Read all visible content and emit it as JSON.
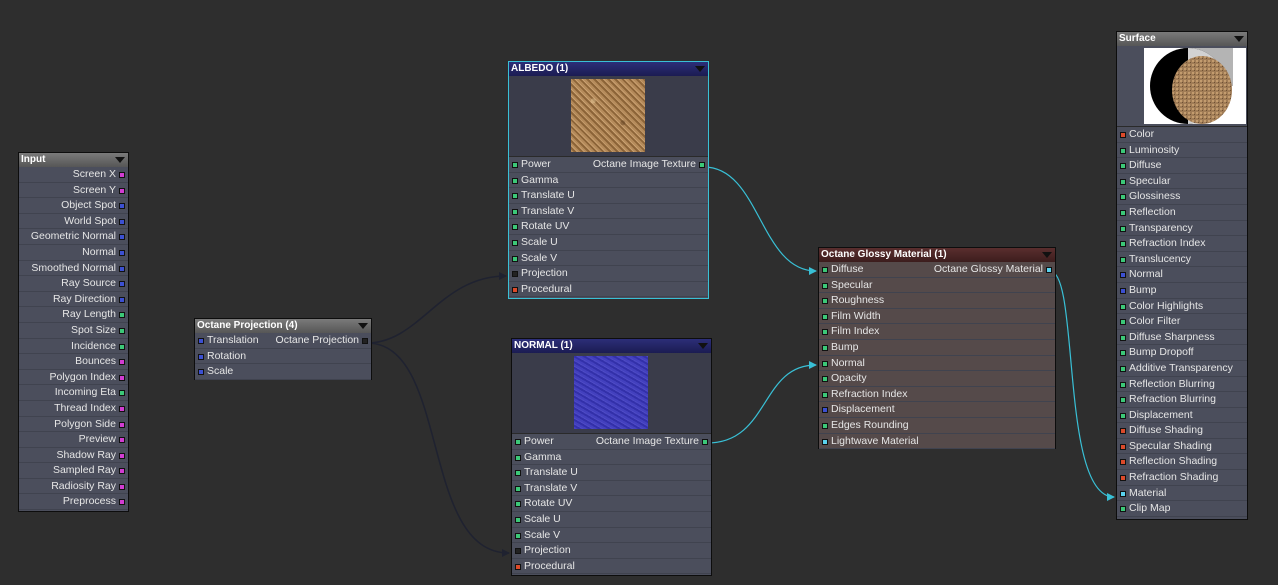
{
  "colors": {
    "canvas_bg": "#2e2e2e",
    "node_bg": "#4b4e5c",
    "wire_cyan": "#39c0d6",
    "wire_dark": "#1f2230",
    "port_magenta": "#d23cd2",
    "port_blue": "#3c50d2",
    "port_green": "#3cc878",
    "port_red": "#dc4a2a",
    "port_cyan": "#5ad2ee",
    "port_black": "#222222"
  },
  "input_node": {
    "title": "Input",
    "rows": [
      {
        "label": "Screen X",
        "port": "magenta"
      },
      {
        "label": "Screen Y",
        "port": "magenta"
      },
      {
        "label": "Object Spot",
        "port": "blue"
      },
      {
        "label": "World Spot",
        "port": "blue"
      },
      {
        "label": "Geometric Normal",
        "port": "blue"
      },
      {
        "label": "Normal",
        "port": "blue"
      },
      {
        "label": "Smoothed Normal",
        "port": "blue"
      },
      {
        "label": "Ray Source",
        "port": "blue"
      },
      {
        "label": "Ray Direction",
        "port": "blue"
      },
      {
        "label": "Ray Length",
        "port": "green"
      },
      {
        "label": "Spot Size",
        "port": "green"
      },
      {
        "label": "Incidence",
        "port": "green"
      },
      {
        "label": "Bounces",
        "port": "magenta"
      },
      {
        "label": "Polygon Index",
        "port": "magenta"
      },
      {
        "label": "Incoming Eta",
        "port": "green"
      },
      {
        "label": "Thread Index",
        "port": "magenta"
      },
      {
        "label": "Polygon Side",
        "port": "magenta"
      },
      {
        "label": "Preview",
        "port": "magenta"
      },
      {
        "label": "Shadow Ray",
        "port": "magenta"
      },
      {
        "label": "Sampled Ray",
        "port": "magenta"
      },
      {
        "label": "Radiosity Ray",
        "port": "magenta"
      },
      {
        "label": "Preprocess",
        "port": "magenta"
      }
    ]
  },
  "projection_node": {
    "title": "Octane Projection (4)",
    "output": "Octane Projection",
    "rows": [
      {
        "label": "Translation",
        "port": "blue"
      },
      {
        "label": "Rotation",
        "port": "blue"
      },
      {
        "label": "Scale",
        "port": "blue"
      }
    ]
  },
  "albedo_node": {
    "title": "ALBEDO (1)",
    "output": "Octane Image Texture",
    "rows": [
      {
        "label": "Power",
        "port": "green"
      },
      {
        "label": "Gamma",
        "port": "green"
      },
      {
        "label": "Translate U",
        "port": "green"
      },
      {
        "label": "Translate V",
        "port": "green"
      },
      {
        "label": "Rotate UV",
        "port": "green"
      },
      {
        "label": "Scale U",
        "port": "green"
      },
      {
        "label": "Scale V",
        "port": "green"
      },
      {
        "label": "Projection",
        "port": "black"
      },
      {
        "label": "Procedural",
        "port": "red"
      }
    ]
  },
  "normal_node": {
    "title": "NORMAL (1)",
    "output": "Octane Image Texture",
    "rows": [
      {
        "label": "Power",
        "port": "green"
      },
      {
        "label": "Gamma",
        "port": "green"
      },
      {
        "label": "Translate U",
        "port": "green"
      },
      {
        "label": "Translate V",
        "port": "green"
      },
      {
        "label": "Rotate UV",
        "port": "green"
      },
      {
        "label": "Scale U",
        "port": "green"
      },
      {
        "label": "Scale V",
        "port": "green"
      },
      {
        "label": "Projection",
        "port": "black"
      },
      {
        "label": "Procedural",
        "port": "red"
      }
    ]
  },
  "glossy_node": {
    "title": "Octane Glossy Material (1)",
    "output": "Octane Glossy Material",
    "rows": [
      {
        "label": "Diffuse",
        "port": "green"
      },
      {
        "label": "Specular",
        "port": "green"
      },
      {
        "label": "Roughness",
        "port": "green"
      },
      {
        "label": "Film Width",
        "port": "green"
      },
      {
        "label": "Film Index",
        "port": "green"
      },
      {
        "label": "Bump",
        "port": "green"
      },
      {
        "label": "Normal",
        "port": "green"
      },
      {
        "label": "Opacity",
        "port": "green"
      },
      {
        "label": "Refraction Index",
        "port": "green"
      },
      {
        "label": "Displacement",
        "port": "blue"
      },
      {
        "label": "Edges Rounding",
        "port": "green"
      },
      {
        "label": "Lightwave Material",
        "port": "cyan"
      }
    ]
  },
  "surface_node": {
    "title": "Surface",
    "rows": [
      {
        "label": "Color",
        "port": "red"
      },
      {
        "label": "Luminosity",
        "port": "green"
      },
      {
        "label": "Diffuse",
        "port": "green"
      },
      {
        "label": "Specular",
        "port": "green"
      },
      {
        "label": "Glossiness",
        "port": "green"
      },
      {
        "label": "Reflection",
        "port": "green"
      },
      {
        "label": "Transparency",
        "port": "green"
      },
      {
        "label": "Refraction Index",
        "port": "green"
      },
      {
        "label": "Translucency",
        "port": "green"
      },
      {
        "label": "Normal",
        "port": "blue"
      },
      {
        "label": "Bump",
        "port": "blue"
      },
      {
        "label": "Color Highlights",
        "port": "green"
      },
      {
        "label": "Color Filter",
        "port": "green"
      },
      {
        "label": "Diffuse Sharpness",
        "port": "green"
      },
      {
        "label": "Bump Dropoff",
        "port": "green"
      },
      {
        "label": "Additive Transparency",
        "port": "green"
      },
      {
        "label": "Reflection Blurring",
        "port": "green"
      },
      {
        "label": "Refraction Blurring",
        "port": "green"
      },
      {
        "label": "Displacement",
        "port": "green"
      },
      {
        "label": "Diffuse Shading",
        "port": "red"
      },
      {
        "label": "Specular Shading",
        "port": "red"
      },
      {
        "label": "Reflection Shading",
        "port": "red"
      },
      {
        "label": "Refraction Shading",
        "port": "red"
      },
      {
        "label": "Material",
        "port": "cyan"
      },
      {
        "label": "Clip Map",
        "port": "green"
      }
    ]
  }
}
